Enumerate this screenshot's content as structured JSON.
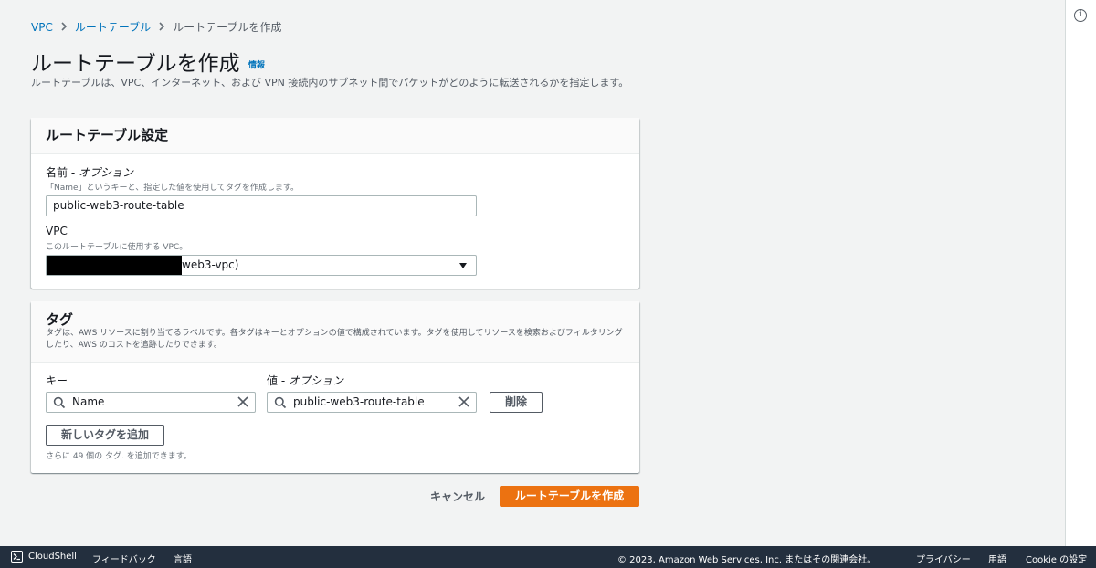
{
  "breadcrumb": {
    "items": [
      "VPC",
      "ルートテーブル"
    ],
    "current": "ルートテーブルを作成"
  },
  "header": {
    "title": "ルートテーブルを作成",
    "info_link": "情報",
    "description": "ルートテーブルは、VPC、インターネット、および VPN 接続内のサブネット間でパケットがどのように転送されるかを指定します。"
  },
  "settings_panel": {
    "title": "ルートテーブル設定",
    "name_label": "名前 - ",
    "name_label_optional": "オプション",
    "name_hint": "「Name」というキーと、指定した値を使用してタグを作成します。",
    "name_value": "public-web3-route-table",
    "vpc_label": "VPC",
    "vpc_hint": "このルートテーブルに使用する VPC。",
    "vpc_value_visible": "web3-vpc)"
  },
  "tags_panel": {
    "title": "タグ",
    "description": "タグは、AWS リソースに割り当てるラベルです。各タグはキーとオプションの値で構成されています。タグを使用してリソースを検索およびフィルタリングしたり、AWS のコストを追跡したりできます。",
    "key_label": "キー",
    "value_label": "値 - ",
    "value_label_optional": "オプション",
    "key_value": "Name",
    "value_value": "public-web3-route-table",
    "remove_button": "削除",
    "add_button": "新しいタグを追加",
    "remaining_hint": "さらに 49 個の タグ. を追加できます。"
  },
  "actions": {
    "cancel": "キャンセル",
    "create": "ルートテーブルを作成"
  },
  "footer": {
    "cloudshell": "CloudShell",
    "feedback": "フィードバック",
    "language": "言語",
    "copyright": "© 2023, Amazon Web Services, Inc. またはその関連会社。",
    "privacy": "プライバシー",
    "terms": "用語",
    "cookie": "Cookie の設定"
  },
  "colors": {
    "accent": "#ec7211",
    "link": "#0073bb",
    "footer_bg": "#232f3e",
    "page_bg": "#f2f3f3"
  },
  "icons": [
    "chevron-right-icon",
    "info-icon",
    "search-icon",
    "clear-icon",
    "caret-down-icon",
    "cloudshell-icon"
  ]
}
